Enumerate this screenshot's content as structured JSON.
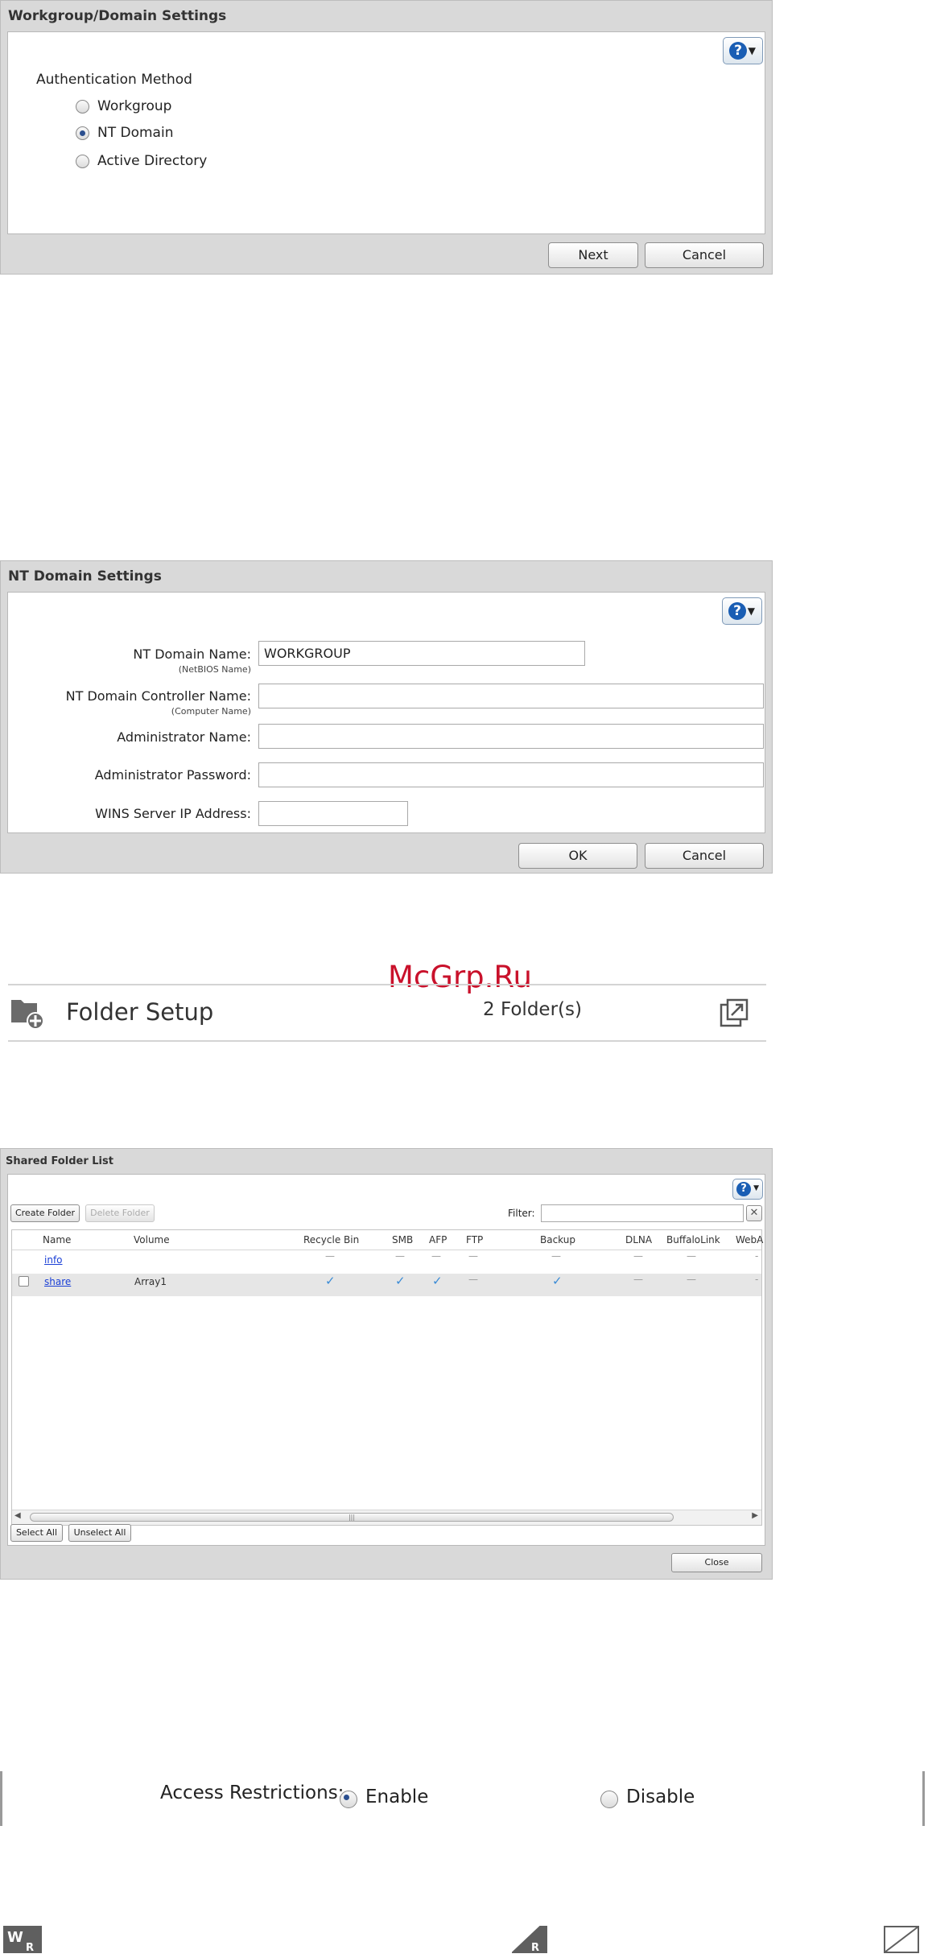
{
  "workgroup_dialog": {
    "title": "Workgroup/Domain Settings",
    "section_label": "Authentication Method",
    "options": [
      {
        "label": "Workgroup",
        "selected": false
      },
      {
        "label": "NT Domain",
        "selected": true
      },
      {
        "label": "Active Directory",
        "selected": false
      }
    ],
    "next_label": "Next",
    "cancel_label": "Cancel",
    "help_glyph": "?"
  },
  "nt_dialog": {
    "title": "NT Domain Settings",
    "help_glyph": "?",
    "fields": [
      {
        "label": "NT Domain Name:",
        "sub": "(NetBIOS Name)",
        "value": ""
      },
      {
        "label": "NT Domain Controller Name:",
        "sub": "(Computer Name)",
        "value": ""
      },
      {
        "label": "Administrator Name:",
        "value": ""
      },
      {
        "label": "Administrator Password:",
        "value": ""
      },
      {
        "label": "WINS Server IP Address:",
        "value": ""
      }
    ],
    "domain_name_value": "WORKGROUP",
    "ok_label": "OK",
    "cancel_label": "Cancel"
  },
  "watermark": "McGrp.Ru",
  "folder_setup": {
    "title": "Folder Setup",
    "count": "2 Folder(s)"
  },
  "shared_list": {
    "title": "Shared Folder List",
    "help_glyph": "?",
    "create_label": "Create Folder",
    "delete_label": "Delete Folder",
    "filter_label": "Filter:",
    "filter_value": "",
    "columns": [
      "Name",
      "Volume",
      "Recycle Bin",
      "SMB",
      "AFP",
      "FTP",
      "Backup",
      "DLNA",
      "BuffaloLink",
      "WebA"
    ],
    "rows": [
      {
        "name": "info",
        "volume": "",
        "marks": [
          "—",
          "—",
          "—",
          "—",
          "—",
          "—",
          "—",
          "-"
        ]
      },
      {
        "name": "share",
        "volume": "Array1",
        "marks": [
          "✓",
          "✓",
          "✓",
          "—",
          "✓",
          "—",
          "—",
          "-"
        ]
      }
    ],
    "select_all_label": "Select All",
    "unselect_all_label": "Unselect All",
    "close_label": "Close",
    "scroll_grip": "|||"
  },
  "access": {
    "label": "Access Restrictions:",
    "enable_label": "Enable",
    "disable_label": "Disable",
    "selected": "Enable"
  },
  "icons": {
    "rw": "W R",
    "ro": "R"
  }
}
